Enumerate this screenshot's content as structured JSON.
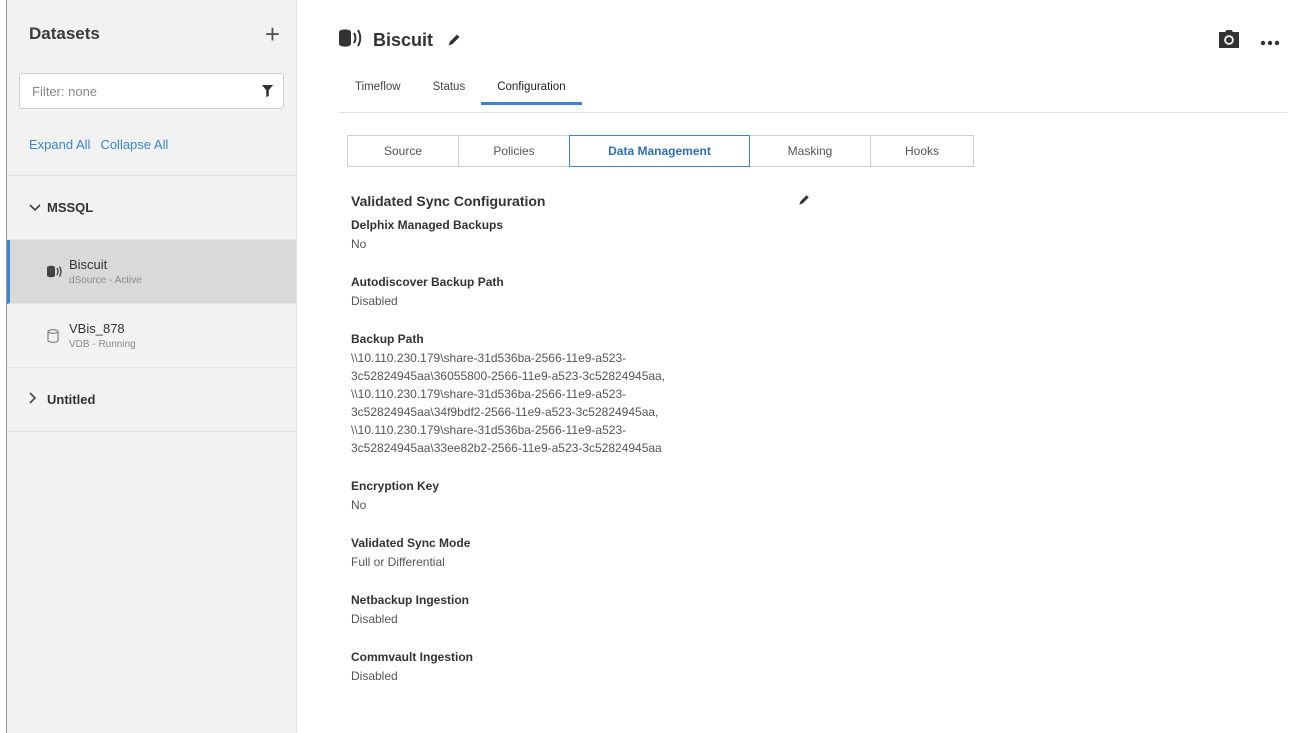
{
  "sidebar": {
    "title": "Datasets",
    "add_icon": "plus-icon",
    "filter": {
      "placeholder": "Filter: none",
      "icon": "filter-icon"
    },
    "expand_all": "Expand All",
    "collapse_all": "Collapse All",
    "groups": [
      {
        "name": "MSSQL",
        "expanded": true,
        "items": [
          {
            "name": "Biscuit",
            "status": "dSource - Active",
            "icon": "dsource-icon",
            "selected": true
          },
          {
            "name": "VBis_878",
            "status": "VDB - Running",
            "icon": "vdb-icon",
            "selected": false
          }
        ]
      },
      {
        "name": "Untitled",
        "expanded": false,
        "items": []
      }
    ]
  },
  "header": {
    "title": "Biscuit",
    "icons": [
      "dsource-icon",
      "pencil-icon",
      "camera-icon",
      "more-icon"
    ]
  },
  "tabs": [
    "Timeflow",
    "Status",
    "Configuration"
  ],
  "active_tab": "Configuration",
  "subtabs": [
    "Source",
    "Policies",
    "Data Management",
    "Masking",
    "Hooks"
  ],
  "active_subtab": "Data Management",
  "section": {
    "title": "Validated Sync Configuration",
    "fields": [
      {
        "label": "Delphix Managed Backups",
        "value": "No"
      },
      {
        "label": "Autodiscover Backup Path",
        "value": "Disabled"
      },
      {
        "label": "Backup Path",
        "value_lines": [
          "\\\\10.110.230.179\\share-31d536ba-2566-11e9-a523-",
          "3c52824945aa\\36055800-2566-11e9-a523-3c52824945aa,",
          "\\\\10.110.230.179\\share-31d536ba-2566-11e9-a523-",
          "3c52824945aa\\34f9bdf2-2566-11e9-a523-3c52824945aa,",
          "\\\\10.110.230.179\\share-31d536ba-2566-11e9-a523-",
          "3c52824945aa\\33ee82b2-2566-11e9-a523-3c52824945aa"
        ]
      },
      {
        "label": "Encryption Key",
        "value": "No"
      },
      {
        "label": "Validated Sync Mode",
        "value": "Full or Differential"
      },
      {
        "label": "Netbackup Ingestion",
        "value": "Disabled"
      },
      {
        "label": "Commvault Ingestion",
        "value": "Disabled"
      }
    ]
  },
  "colors": {
    "accent": "#3b84d4",
    "sidebar_bg": "#f2f2f2",
    "selected_bg": "#d9d9d9"
  }
}
